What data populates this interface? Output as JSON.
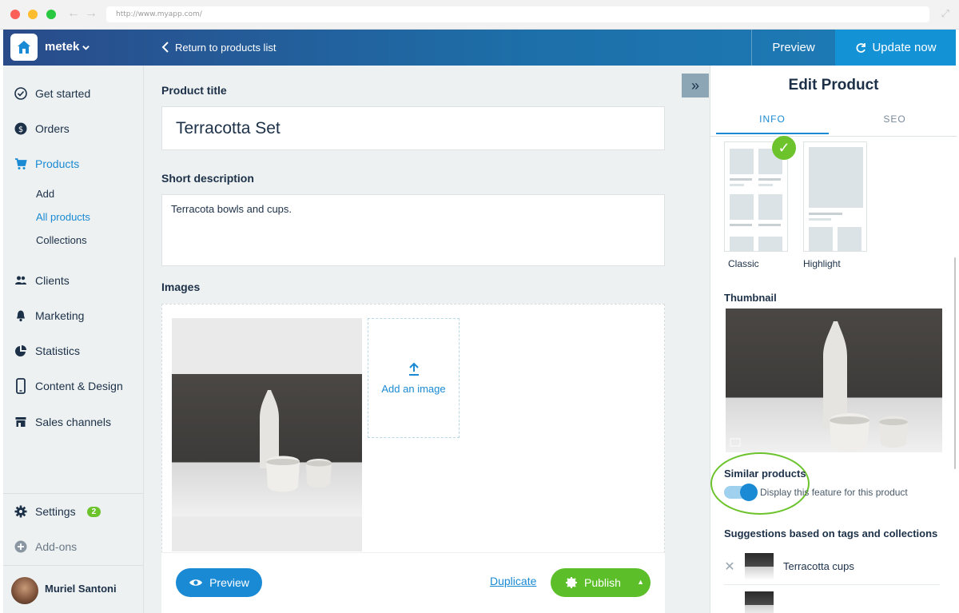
{
  "browser": {
    "url": "http://www.myapp.com/"
  },
  "header": {
    "store_name": "metek",
    "back_label": "Return to products list",
    "preview_label": "Preview",
    "update_label": "Update now"
  },
  "sidebar": {
    "items": [
      {
        "label": "Get started",
        "icon": "check-circle-icon"
      },
      {
        "label": "Orders",
        "icon": "dollar-circle-icon"
      },
      {
        "label": "Products",
        "icon": "cart-icon"
      },
      {
        "label": "Clients",
        "icon": "users-icon"
      },
      {
        "label": "Marketing",
        "icon": "bell-icon"
      },
      {
        "label": "Statistics",
        "icon": "pie-chart-icon"
      },
      {
        "label": "Content & Design",
        "icon": "phone-icon"
      },
      {
        "label": "Sales channels",
        "icon": "store-icon"
      }
    ],
    "sub_items": [
      "Add",
      "All products",
      "Collections"
    ],
    "settings_label": "Settings",
    "settings_badge": "2",
    "addons_label": "Add-ons",
    "user_name": "Muriel Santoni"
  },
  "form": {
    "title_label": "Product title",
    "title_value": "Terracotta Set",
    "desc_label": "Short description",
    "desc_value": "Terracota bowls and cups.",
    "images_label": "Images",
    "add_image_label": "Add an image"
  },
  "actions": {
    "preview_label": "Preview",
    "duplicate_label": "Duplicate",
    "publish_label": "Publish"
  },
  "panel": {
    "title": "Edit Product",
    "tabs": [
      "INFO",
      "SEO"
    ],
    "layouts": [
      "Classic",
      "Highlight"
    ],
    "thumbnail_label": "Thumbnail",
    "similar_label": "Similar products",
    "similar_toggle_text": "Display this feature for this product",
    "similar_enabled": true,
    "suggestions_label": "Suggestions based on tags and collections",
    "suggestions": [
      "Terracotta cups"
    ]
  },
  "colors": {
    "accent": "#1a8ad4",
    "success": "#5cbf2a",
    "header_start": "#2a4b8a",
    "header_end": "#1d7db8",
    "text": "#1c3048"
  }
}
